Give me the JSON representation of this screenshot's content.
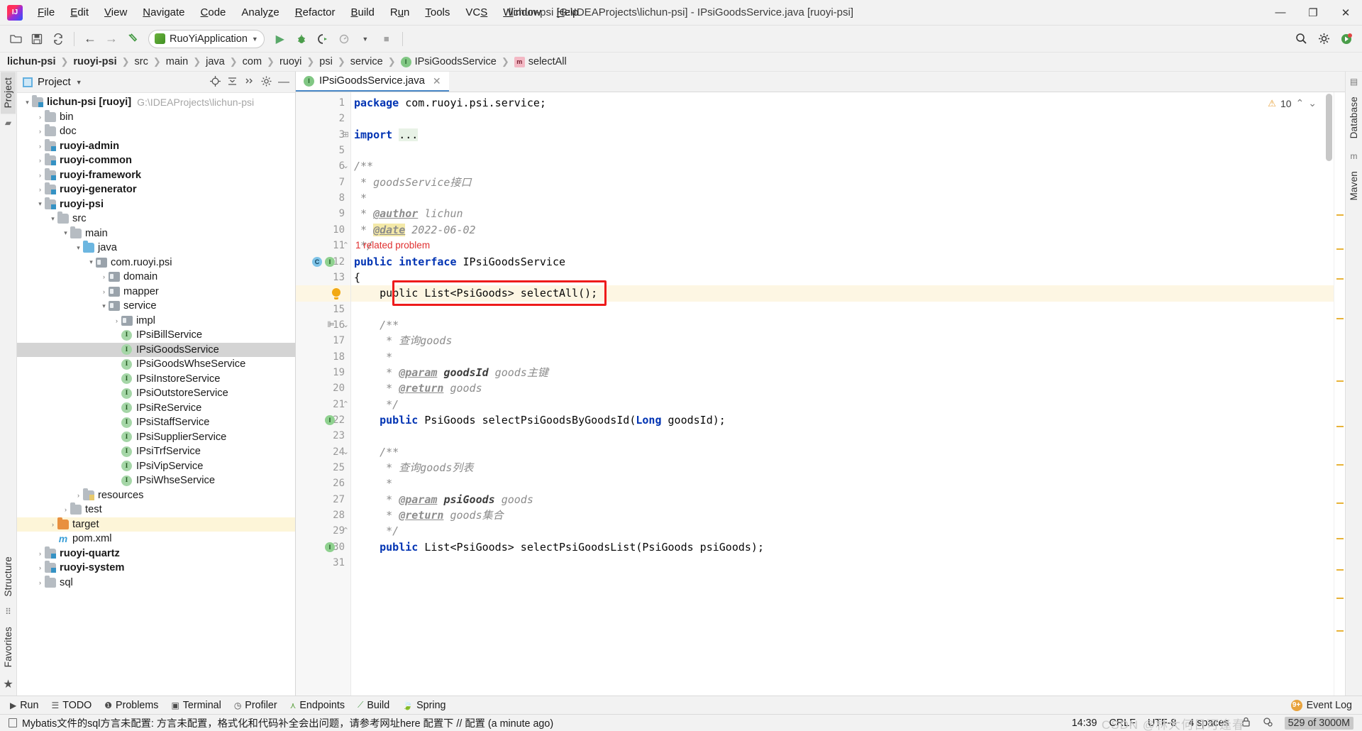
{
  "window": {
    "title": "lichun-psi [G:\\IDEAProjects\\lichun-psi] - IPsiGoodsService.java [ruoyi-psi]",
    "minimize": "—",
    "maximize": "❐",
    "close": "✕"
  },
  "menubar": [
    {
      "label": "File"
    },
    {
      "label": "Edit"
    },
    {
      "label": "View"
    },
    {
      "label": "Navigate"
    },
    {
      "label": "Code"
    },
    {
      "label": "Analyze"
    },
    {
      "label": "Refactor"
    },
    {
      "label": "Build"
    },
    {
      "label": "Run"
    },
    {
      "label": "Tools"
    },
    {
      "label": "VCS"
    },
    {
      "label": "Window"
    },
    {
      "label": "Help"
    }
  ],
  "toolbar": {
    "open_icon": "open-folder-icon",
    "save_icon": "save-icon",
    "sync_icon": "sync-icon",
    "back_icon": "←",
    "forward_icon": "→",
    "build_icon": "hammer-icon",
    "run_config_name": "RuoYiApplication",
    "run_icon": "▶",
    "debug_icon": "debug-icon",
    "run_coverage_icon": "run-with-coverage-icon",
    "profile_icon": "profiler-icon",
    "stop_icon": "■",
    "search_icon": "search-icon",
    "settings_icon": "gear-icon",
    "updates_icon": "updates-icon"
  },
  "breadcrumb": [
    {
      "label": "lichun-psi",
      "bold": true
    },
    {
      "label": "ruoyi-psi",
      "bold": true
    },
    {
      "label": "src",
      "bold": false
    },
    {
      "label": "main",
      "bold": false
    },
    {
      "label": "java",
      "bold": false
    },
    {
      "label": "com",
      "bold": false
    },
    {
      "label": "ruoyi",
      "bold": false
    },
    {
      "label": "psi",
      "bold": false
    },
    {
      "label": "service",
      "bold": false
    },
    {
      "label": "IPsiGoodsService",
      "bold": false,
      "icon": "interface"
    },
    {
      "label": "selectAll",
      "bold": false,
      "icon": "method"
    }
  ],
  "left_strip": {
    "project_tab": "Project",
    "structure_tab": "Structure",
    "favorites_tab": "Favorites"
  },
  "right_strip": {
    "database_tab": "Database",
    "maven_tab": "Maven"
  },
  "project_panel": {
    "title": "Project",
    "caret": "▾",
    "actions": [
      "locate-icon",
      "collapse-all-icon",
      "expand-icon",
      "gear-icon",
      "hide-icon"
    ],
    "tree": [
      {
        "indent": 0,
        "arrow": "▾",
        "icon": "module",
        "label": "lichun-psi [ruoyi]",
        "bold": true,
        "hint": "G:\\IDEAProjects\\lichun-psi"
      },
      {
        "indent": 1,
        "arrow": "›",
        "icon": "folder",
        "label": "bin",
        "bold": false
      },
      {
        "indent": 1,
        "arrow": "›",
        "icon": "folder",
        "label": "doc",
        "bold": false
      },
      {
        "indent": 1,
        "arrow": "›",
        "icon": "module",
        "label": "ruoyi-admin",
        "bold": true
      },
      {
        "indent": 1,
        "arrow": "›",
        "icon": "module",
        "label": "ruoyi-common",
        "bold": true
      },
      {
        "indent": 1,
        "arrow": "›",
        "icon": "module",
        "label": "ruoyi-framework",
        "bold": true
      },
      {
        "indent": 1,
        "arrow": "›",
        "icon": "module",
        "label": "ruoyi-generator",
        "bold": true
      },
      {
        "indent": 1,
        "arrow": "▾",
        "icon": "module",
        "label": "ruoyi-psi",
        "bold": true
      },
      {
        "indent": 2,
        "arrow": "▾",
        "icon": "folder",
        "label": "src",
        "bold": false
      },
      {
        "indent": 3,
        "arrow": "▾",
        "icon": "folder",
        "label": "main",
        "bold": false
      },
      {
        "indent": 4,
        "arrow": "▾",
        "icon": "source",
        "label": "java",
        "bold": false
      },
      {
        "indent": 5,
        "arrow": "▾",
        "icon": "package",
        "label": "com.ruoyi.psi",
        "bold": false
      },
      {
        "indent": 6,
        "arrow": "›",
        "icon": "package",
        "label": "domain",
        "bold": false
      },
      {
        "indent": 6,
        "arrow": "›",
        "icon": "package",
        "label": "mapper",
        "bold": false
      },
      {
        "indent": 6,
        "arrow": "▾",
        "icon": "package",
        "label": "service",
        "bold": false
      },
      {
        "indent": 7,
        "arrow": "›",
        "icon": "package",
        "label": "impl",
        "bold": false
      },
      {
        "indent": 7,
        "arrow": "",
        "icon": "interface",
        "label": "IPsiBillService",
        "bold": false
      },
      {
        "indent": 7,
        "arrow": "",
        "icon": "interface",
        "label": "IPsiGoodsService",
        "bold": false,
        "selected": true
      },
      {
        "indent": 7,
        "arrow": "",
        "icon": "interface",
        "label": "IPsiGoodsWhseService",
        "bold": false
      },
      {
        "indent": 7,
        "arrow": "",
        "icon": "interface",
        "label": "IPsiInstoreService",
        "bold": false
      },
      {
        "indent": 7,
        "arrow": "",
        "icon": "interface",
        "label": "IPsiOutstoreService",
        "bold": false
      },
      {
        "indent": 7,
        "arrow": "",
        "icon": "interface",
        "label": "IPsiReService",
        "bold": false
      },
      {
        "indent": 7,
        "arrow": "",
        "icon": "interface",
        "label": "IPsiStaffService",
        "bold": false
      },
      {
        "indent": 7,
        "arrow": "",
        "icon": "interface",
        "label": "IPsiSupplierService",
        "bold": false
      },
      {
        "indent": 7,
        "arrow": "",
        "icon": "interface",
        "label": "IPsiTrfService",
        "bold": false
      },
      {
        "indent": 7,
        "arrow": "",
        "icon": "interface",
        "label": "IPsiVipService",
        "bold": false
      },
      {
        "indent": 7,
        "arrow": "",
        "icon": "interface",
        "label": "IPsiWhseService",
        "bold": false
      },
      {
        "indent": 4,
        "arrow": "›",
        "icon": "resources",
        "label": "resources",
        "bold": false
      },
      {
        "indent": 3,
        "arrow": "›",
        "icon": "folder",
        "label": "test",
        "bold": false
      },
      {
        "indent": 2,
        "arrow": "›",
        "icon": "excluded",
        "label": "target",
        "bold": false,
        "highlight": true
      },
      {
        "indent": 2,
        "arrow": "",
        "icon": "maven",
        "label": "pom.xml",
        "bold": false
      },
      {
        "indent": 1,
        "arrow": "›",
        "icon": "module",
        "label": "ruoyi-quartz",
        "bold": true
      },
      {
        "indent": 1,
        "arrow": "›",
        "icon": "module",
        "label": "ruoyi-system",
        "bold": true
      },
      {
        "indent": 1,
        "arrow": "›",
        "icon": "folder",
        "label": "sql",
        "bold": false
      }
    ]
  },
  "editor": {
    "tab": {
      "label": "IPsiGoodsService.java",
      "icon": "interface",
      "close": "✕"
    },
    "warnings": {
      "count": "10",
      "icon": "warning-triangle-icon",
      "up": "⌃",
      "down": "⌄"
    },
    "related_problem": "1 related problem",
    "lines": [
      {
        "no": "1",
        "html": "<span class=\"kw\">package</span> <span class=\"plain\">com.ruoyi.psi.service;</span>"
      },
      {
        "no": "2",
        "html": ""
      },
      {
        "no": "3",
        "html": "<span class=\"kw\">import</span> <span class=\"fold-hl plain\">...</span>"
      },
      {
        "no": "5",
        "html": ""
      },
      {
        "no": "6",
        "html": "<span class=\"cmt\">/**</span>"
      },
      {
        "no": "7",
        "html": "<span class=\"cmt\"> * goodsService接口</span>"
      },
      {
        "no": "8",
        "html": "<span class=\"cmt\"> *</span>"
      },
      {
        "no": "9",
        "html": "<span class=\"cmt\"> * </span><span class=\"tag\">@author</span><span class=\"cmt\"> lichun</span>"
      },
      {
        "no": "10",
        "html": "<span class=\"cmt\"> * </span><span class=\"tag date-hl\">@date</span><span class=\"cmt\"> 2022-06-02</span>"
      },
      {
        "no": "11",
        "html": "<span class=\"cmt\"> */</span>"
      },
      {
        "no": "12",
        "html": "<span class=\"kw\">public interface</span> <span class=\"plain\">IPsiGoodsService</span>"
      },
      {
        "no": "13",
        "html": "<span class=\"plain\">{</span>"
      },
      {
        "no": "14",
        "html": "    <span class=\"plain\">public List&lt;PsiGoods&gt; selectAll();</span>",
        "highlight": true
      },
      {
        "no": "15",
        "html": ""
      },
      {
        "no": "16",
        "html": "    <span class=\"cmt\">/**</span>"
      },
      {
        "no": "17",
        "html": "     <span class=\"cmt\">* 查询goods</span>"
      },
      {
        "no": "18",
        "html": "     <span class=\"cmt\">*</span>"
      },
      {
        "no": "19",
        "html": "     <span class=\"cmt\">* </span><span class=\"tag\">@param</span> <span class=\"tagp\">goodsId</span><span class=\"cmt\"> goods主键</span>"
      },
      {
        "no": "20",
        "html": "     <span class=\"cmt\">* </span><span class=\"tag\">@return</span><span class=\"cmt\"> goods</span>"
      },
      {
        "no": "21",
        "html": "     <span class=\"cmt\">*/</span>"
      },
      {
        "no": "22",
        "html": "    <span class=\"kw\">public</span> <span class=\"plain\">PsiGoods selectPsiGoodsByGoodsId(</span><span class=\"kw\">Long</span><span class=\"plain\"> goodsId);</span>"
      },
      {
        "no": "23",
        "html": ""
      },
      {
        "no": "24",
        "html": "    <span class=\"cmt\">/**</span>"
      },
      {
        "no": "25",
        "html": "     <span class=\"cmt\">* 查询goods列表</span>"
      },
      {
        "no": "26",
        "html": "     <span class=\"cmt\">*</span>"
      },
      {
        "no": "27",
        "html": "     <span class=\"cmt\">* </span><span class=\"tag\">@param</span> <span class=\"tagp\">psiGoods</span><span class=\"cmt\"> goods</span>"
      },
      {
        "no": "28",
        "html": "     <span class=\"cmt\">* </span><span class=\"tag\">@return</span><span class=\"cmt\"> goods集合</span>"
      },
      {
        "no": "29",
        "html": "     <span class=\"cmt\">*/</span>"
      },
      {
        "no": "30",
        "html": "    <span class=\"kw\">public</span> <span class=\"plain\">List&lt;PsiGoods&gt; selectPsiGoodsList(PsiGoods psiGoods);</span>"
      },
      {
        "no": "31",
        "html": ""
      }
    ]
  },
  "tool_windows": [
    {
      "label": "Run",
      "icon": "run-icon"
    },
    {
      "label": "TODO",
      "icon": "todo-icon"
    },
    {
      "label": "Problems",
      "icon": "problems-icon"
    },
    {
      "label": "Terminal",
      "icon": "terminal-icon"
    },
    {
      "label": "Profiler",
      "icon": "profiler-icon"
    },
    {
      "label": "Endpoints",
      "icon": "endpoints-icon"
    },
    {
      "label": "Build",
      "icon": "build-icon"
    },
    {
      "label": "Spring",
      "icon": "spring-icon"
    }
  ],
  "event_log": {
    "label": "Event Log",
    "badge": "9+"
  },
  "statusbar": {
    "message": "Mybatis文件的sql方言未配置: 方言未配置，格式化和代码补全会出问题，请参考网址here 配置下 // 配置 (a minute ago)",
    "time": "14:39",
    "line_separator": "CRLF",
    "encoding": "UTF-8",
    "indent": "4 spaces",
    "lock_icon": "lock-icon",
    "inspect_icon": "inspection-icon",
    "memory": "529 of 3000M",
    "watermark": "CSDN @林大何日可逢春"
  }
}
